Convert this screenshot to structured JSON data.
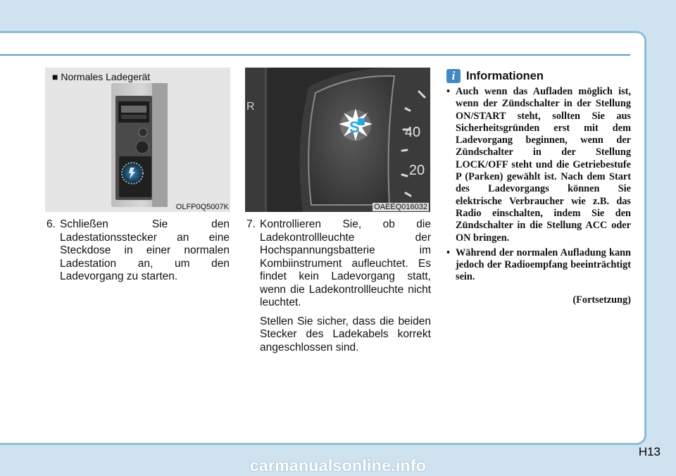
{
  "page": {
    "number": "H13",
    "watermark": "carmanualsonline.info"
  },
  "figure1": {
    "caption": "■ Normales Ladegerät",
    "code": "OLFP0Q5007K"
  },
  "figure2": {
    "code": "OAEEQ016032",
    "gauge_labels": [
      "40",
      "20"
    ]
  },
  "step6": {
    "number": "6.",
    "text": "Schließen Sie den Ladestationsstecker an eine Steckdose in einer normalen Ladestation an, um den Ladevorgang zu starten."
  },
  "step7": {
    "number": "7.",
    "text": "Kontrollieren Sie, ob die Ladekontrollleuchte der Hochspannungsbatterie im Kombiinstrument aufleuchtet. Es findet kein Ladevorgang statt, wenn die Ladekontrollleuchte nicht leuchtet.",
    "note": "Stellen Sie sicher, dass die beiden Stecker des Ladekabels korrekt angeschlossen sind."
  },
  "info": {
    "icon_letter": "i",
    "title": "Informationen",
    "items": [
      "Auch wenn das Aufladen möglich ist, wenn der Zündschalter in der Stellung ON/START steht, sollten Sie aus Sicherheitsgründen erst mit dem Ladevorgang beginnen, wenn der Zündschalter in der Stellung LOCK/OFF steht und die Getriebestufe P (Parken) gewählt ist. Nach dem Start des Ladevorgangs können Sie elektrische Verbraucher wie z.B. das Radio einschalten, indem Sie den Zündschalter in die Stellung ACC oder ON bringen.",
      "Während der normalen Aufladung kann jedoch der Radioempfang beeinträchtigt sein."
    ],
    "continued": "(Fortsetzung)"
  },
  "colors": {
    "background": "#cfe2ef",
    "border": "#8fbbd9",
    "rule": "#5a98c4",
    "info_icon": "#4189c2",
    "charge_lamp": "#2aa7e0"
  }
}
